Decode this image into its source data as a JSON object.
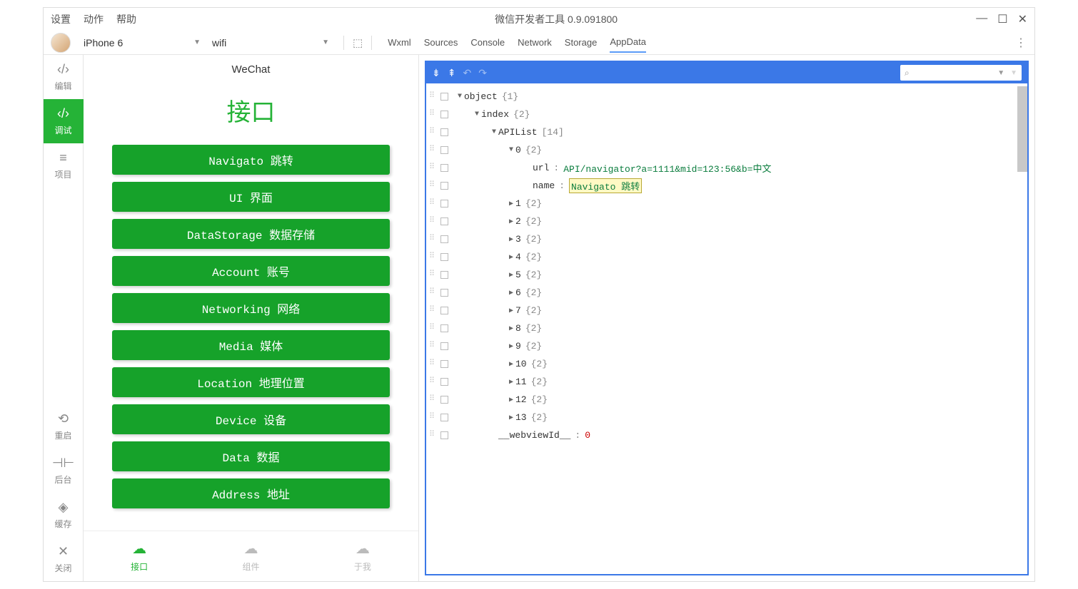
{
  "titlebar": {
    "menu": [
      "设置",
      "动作",
      "帮助"
    ],
    "title": "微信开发者工具 0.9.091800"
  },
  "toolbar": {
    "device": "iPhone 6",
    "network": "wifi"
  },
  "devtools_tabs": {
    "items": [
      "Wxml",
      "Sources",
      "Console",
      "Network",
      "Storage",
      "AppData"
    ],
    "active": "AppData"
  },
  "leftbar": {
    "items": [
      {
        "icon": "‹/›",
        "label": "编辑"
      },
      {
        "icon": "‹/›",
        "label": "调试",
        "active": true
      },
      {
        "icon": "≡",
        "label": "项目"
      }
    ],
    "bottom_items": [
      {
        "icon": "↺",
        "label": "重启"
      },
      {
        "icon": "⊣⊢",
        "label": "后台"
      },
      {
        "icon": "◇",
        "label": "缓存"
      },
      {
        "icon": "✕",
        "label": "关闭"
      }
    ]
  },
  "sim": {
    "header": "WeChat",
    "title": "接口",
    "buttons": [
      "Navigato 跳转",
      "UI 界面",
      "DataStorage 数据存储",
      "Account 账号",
      "Networking 网络",
      "Media 媒体",
      "Location 地理位置",
      "Device 设备",
      "Data 数据",
      "Address 地址"
    ],
    "bottom": [
      {
        "label": "接口",
        "active": true
      },
      {
        "label": "组件"
      },
      {
        "label": "于我"
      }
    ]
  },
  "appdata": {
    "root": {
      "key": "object",
      "count": "{1}"
    },
    "index": {
      "key": "index",
      "count": "{2}"
    },
    "apilist": {
      "key": "APIList",
      "count": "[14]"
    },
    "item0": {
      "key": "0",
      "count": "{2}"
    },
    "url": {
      "key": "url",
      "value": "API/navigator?a=1111&mid=123:56&b=中文"
    },
    "name": {
      "key": "name",
      "value": "Navigato 跳转"
    },
    "collapsed": [
      {
        "key": "1",
        "count": "{2}"
      },
      {
        "key": "2",
        "count": "{2}"
      },
      {
        "key": "3",
        "count": "{2}"
      },
      {
        "key": "4",
        "count": "{2}"
      },
      {
        "key": "5",
        "count": "{2}"
      },
      {
        "key": "6",
        "count": "{2}"
      },
      {
        "key": "7",
        "count": "{2}"
      },
      {
        "key": "8",
        "count": "{2}"
      },
      {
        "key": "9",
        "count": "{2}"
      },
      {
        "key": "10",
        "count": "{2}"
      },
      {
        "key": "11",
        "count": "{2}"
      },
      {
        "key": "12",
        "count": "{2}"
      },
      {
        "key": "13",
        "count": "{2}"
      }
    ],
    "webview": {
      "key": "__webviewId__",
      "value": "0"
    }
  }
}
